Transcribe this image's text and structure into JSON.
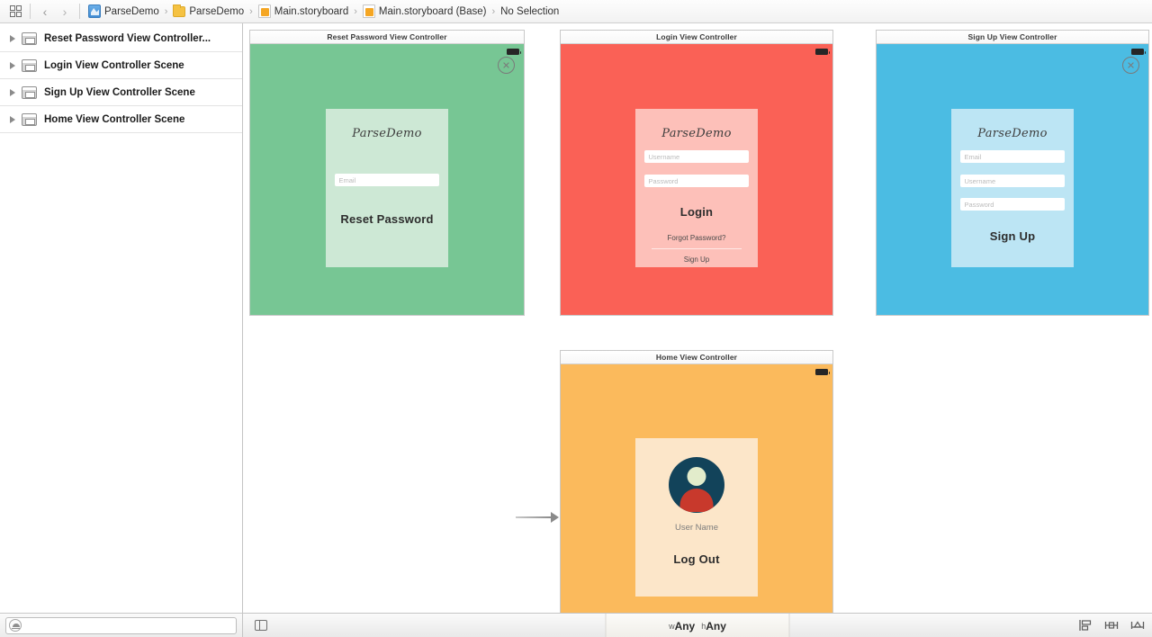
{
  "toolbar": {
    "panel_icon": "grid-panel-icon",
    "back_label": "‹",
    "forward_label": "›"
  },
  "breadcrumb": {
    "separator": "›",
    "items": [
      {
        "label": "ParseDemo",
        "icon": "xcode-project-icon"
      },
      {
        "label": "ParseDemo",
        "icon": "folder-icon"
      },
      {
        "label": "Main.storyboard",
        "icon": "storyboard-file-icon"
      },
      {
        "label": "Main.storyboard (Base)",
        "icon": "storyboard-file-icon"
      },
      {
        "label": "No Selection",
        "icon": "none"
      }
    ]
  },
  "sidebar": {
    "scenes": [
      {
        "label": "Reset Password View Controller..."
      },
      {
        "label": "Login View Controller Scene"
      },
      {
        "label": "Sign Up View Controller Scene"
      },
      {
        "label": "Home View Controller Scene"
      }
    ],
    "filter": {
      "value": "",
      "placeholder": "",
      "icon": "filter-icon"
    }
  },
  "canvas": {
    "scenes": [
      {
        "id": "reset-password",
        "title": "Reset Password View Controller",
        "bg_color": "#77C694",
        "card_color": "#CDE8D5",
        "has_close_button": true,
        "logo": "ParseDemo",
        "fields": [
          {
            "placeholder": "Email"
          }
        ],
        "primary_button": "Reset Password",
        "links": []
      },
      {
        "id": "login",
        "title": "Login View Controller",
        "bg_color": "#FA6156",
        "card_color": "#FDC0B9",
        "has_close_button": false,
        "logo": "ParseDemo",
        "fields": [
          {
            "placeholder": "Username"
          },
          {
            "placeholder": "Password"
          }
        ],
        "primary_button": "Login",
        "links": [
          {
            "label": "Forgot Password?"
          },
          {
            "label": "Sign Up"
          }
        ]
      },
      {
        "id": "signup",
        "title": "Sign Up View Controller",
        "bg_color": "#4BBCE3",
        "card_color": "#BCE5F4",
        "has_close_button": true,
        "logo": "ParseDemo",
        "fields": [
          {
            "placeholder": "Email"
          },
          {
            "placeholder": "Username"
          },
          {
            "placeholder": "Password"
          }
        ],
        "primary_button": "Sign Up",
        "links": []
      },
      {
        "id": "home",
        "title": "Home View Controller",
        "bg_color": "#FBBA5C",
        "card_color": "#FCE6C9",
        "has_close_button": false,
        "avatar": "user-avatar-icon",
        "username_label": "User Name",
        "primary_button": "Log Out",
        "links": []
      }
    ],
    "initial_segue_target": "home"
  },
  "statusbar": {
    "panel_toggle_icon": "left-panel-toggle-icon",
    "size_class": {
      "width_prefix": "w",
      "width_value": "Any",
      "height_prefix": "h",
      "height_value": "Any"
    },
    "right_icons": [
      {
        "name": "align-icon"
      },
      {
        "name": "pin-constraints-icon"
      },
      {
        "name": "resolve-issues-icon"
      }
    ]
  }
}
